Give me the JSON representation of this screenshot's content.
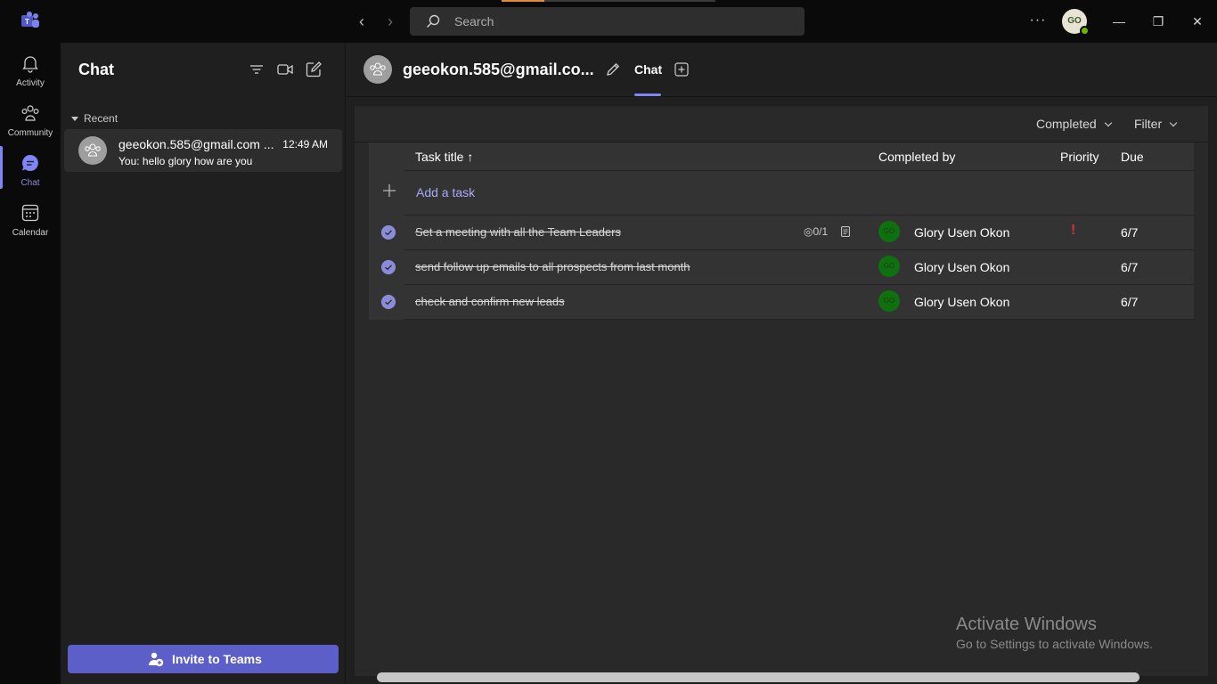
{
  "titlebar": {
    "search_placeholder": "Search",
    "more_label": "···",
    "user_initials": "GO",
    "minimize": "—",
    "restore": "❐",
    "close": "✕"
  },
  "rail": [
    {
      "label": "Activity",
      "icon": "bell-icon"
    },
    {
      "label": "Community",
      "icon": "community-icon"
    },
    {
      "label": "Chat",
      "icon": "chat-icon",
      "active": true
    },
    {
      "label": "Calendar",
      "icon": "calendar-icon"
    }
  ],
  "chatlist": {
    "title": "Chat",
    "section": "Recent",
    "items": [
      {
        "name": "geeokon.585@gmail.com ...",
        "time": "12:49 AM",
        "preview": "You: hello glory how are you"
      }
    ],
    "invite_button": "Invite to Teams"
  },
  "conversation": {
    "title": "geeokon.585@gmail.co...",
    "tab": "Chat"
  },
  "tasks": {
    "view_selector": "Completed",
    "filter": "Filter",
    "columns": {
      "title": "Task title ↑",
      "completed_by": "Completed by",
      "priority": "Priority",
      "due": "Due"
    },
    "add_task": "Add a task",
    "rows": [
      {
        "title": "Set a meeting with all the Team Leaders",
        "checklist": "0/1",
        "assignee_initials": "GO",
        "assignee": "Glory Usen Okon",
        "priority": "!",
        "due": "6/7"
      },
      {
        "title": "send follow up emails to all prospects from last month",
        "checklist": "",
        "assignee_initials": "GO",
        "assignee": "Glory Usen Okon",
        "priority": "",
        "due": "6/7"
      },
      {
        "title": "check and confirm new leads",
        "checklist": "",
        "assignee_initials": "GO",
        "assignee": "Glory Usen Okon",
        "priority": "",
        "due": "6/7"
      }
    ]
  },
  "watermark": {
    "title": "Activate Windows",
    "subtitle": "Go to Settings to activate Windows."
  },
  "colors": {
    "accent": "#5b5fc7",
    "accent_light": "#8b8cd9",
    "urgent": "#d13438",
    "presence": "#6bb700"
  }
}
